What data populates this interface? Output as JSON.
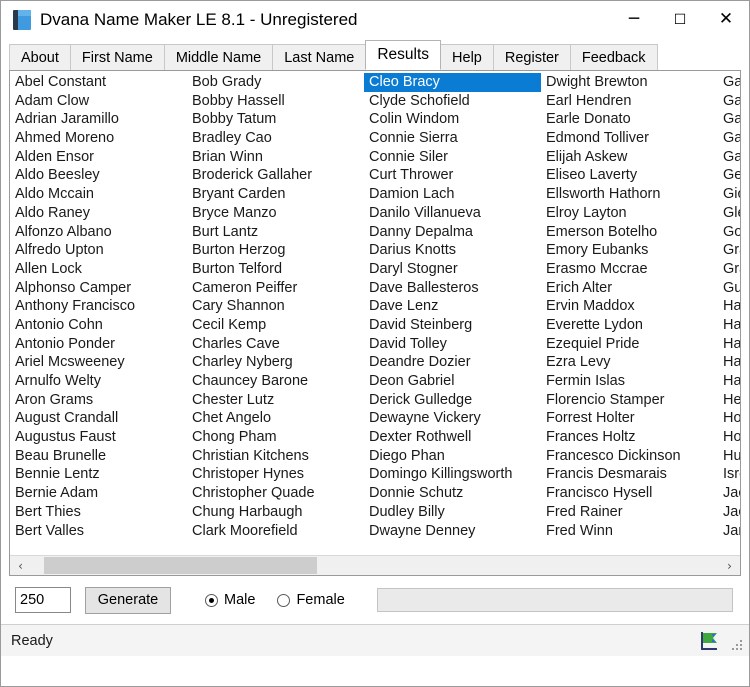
{
  "window": {
    "title": "Dvana Name Maker LE 8.1 - Unregistered",
    "app_icon": "book-icon",
    "minimize_label": "─",
    "maximize_label": "☐",
    "close_label": "✕",
    "accent_color": "#0a7cd4"
  },
  "tabs": [
    {
      "label": "About",
      "active": false
    },
    {
      "label": "First Name",
      "active": false
    },
    {
      "label": "Middle Name",
      "active": false
    },
    {
      "label": "Last Name",
      "active": false
    },
    {
      "label": "Results",
      "active": true
    },
    {
      "label": "Help",
      "active": false
    },
    {
      "label": "Register",
      "active": false
    },
    {
      "label": "Feedback",
      "active": false
    }
  ],
  "results": {
    "selected_name": "Cleo Bracy",
    "columns": [
      [
        "Abel Constant",
        "Adam Clow",
        "Adrian Jaramillo",
        "Ahmed Moreno",
        "Alden Ensor",
        "Aldo Beesley",
        "Aldo Mccain",
        "Aldo Raney",
        "Alfonzo Albano",
        "Alfredo Upton",
        "Allen Lock",
        "Alphonso Camper",
        "Anthony Francisco",
        "Antonio Cohn",
        "Antonio Ponder",
        "Ariel Mcsweeney",
        "Arnulfo Welty",
        "Aron Grams",
        "August Crandall",
        "Augustus Faust",
        "Beau Brunelle",
        "Bennie Lentz",
        "Bernie Adam",
        "Bert Thies",
        "Bert Valles"
      ],
      [
        "Bob Grady",
        "Bobby Hassell",
        "Bobby Tatum",
        "Bradley Cao",
        "Brian Winn",
        "Broderick Gallaher",
        "Bryant Carden",
        "Bryce Manzo",
        "Burt Lantz",
        "Burton Herzog",
        "Burton Telford",
        "Cameron Peiffer",
        "Cary Shannon",
        "Cecil Kemp",
        "Charles Cave",
        "Charley Nyberg",
        "Chauncey Barone",
        "Chester Lutz",
        "Chet Angelo",
        "Chong Pham",
        "Christian Kitchens",
        "Christoper Hynes",
        "Christopher Quade",
        "Chung Harbaugh",
        "Clark Moorefield"
      ],
      [
        "Cleo Bracy",
        "Clyde Schofield",
        "Colin Windom",
        "Connie Sierra",
        "Connie Siler",
        "Curt Thrower",
        "Damion Lach",
        "Danilo Villanueva",
        "Danny Depalma",
        "Darius Knotts",
        "Daryl Stogner",
        "Dave Ballesteros",
        "Dave Lenz",
        "David Steinberg",
        "David Tolley",
        "Deandre Dozier",
        "Deon Gabriel",
        "Derick Gulledge",
        "Dewayne Vickery",
        "Dexter Rothwell",
        "Diego Phan",
        "Domingo Killingsworth",
        "Donnie Schutz",
        "Dudley Billy",
        "Dwayne Denney"
      ],
      [
        "Dwight Brewton",
        "Earl Hendren",
        "Earle Donato",
        "Edmond Tolliver",
        "Elijah Askew",
        "Eliseo Laverty",
        "Ellsworth Hathorn",
        "Elroy Layton",
        "Emerson Botelho",
        "Emory Eubanks",
        "Erasmo Mccrae",
        "Erich Alter",
        "Ervin Maddox",
        "Everette Lydon",
        "Ezequiel Pride",
        "Ezra Levy",
        "Fermin Islas",
        "Florencio Stamper",
        "Forrest Holter",
        "Frances Holtz",
        "Francesco Dickinson",
        "Francis Desmarais",
        "Francisco Hysell",
        "Fred Rainer",
        "Fred Winn"
      ],
      [
        "Gail Pe",
        "Galen I",
        "Garfield",
        "Garrett",
        "Garth B",
        "Genard",
        "Giovan",
        "Glen R",
        "Gonzal",
        "Graham",
        "Graig C",
        "Guy Er",
        "Hai Jar",
        "Harlan",
        "Harriso",
        "Harriso",
        "Harvey",
        "Herb H",
        "Hobert",
        "Hong K",
        "Hunter",
        "Isreal N",
        "Jackie",
        "Jacob",
        "Jamaal"
      ]
    ]
  },
  "scrollbar": {
    "left_arrow": "‹",
    "right_arrow": "›"
  },
  "controls": {
    "count_value": "250",
    "count_placeholder": "",
    "generate_label": "Generate",
    "gender": [
      {
        "label": "Male",
        "checked": true
      },
      {
        "label": "Female",
        "checked": false
      }
    ]
  },
  "statusbar": {
    "text": "Ready",
    "flag_icon": "green-flag-icon",
    "grip_icon": "resize-grip-icon"
  }
}
